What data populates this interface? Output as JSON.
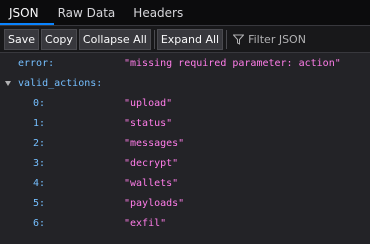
{
  "tabs": [
    {
      "label": "JSON",
      "active": true
    },
    {
      "label": "Raw Data",
      "active": false
    },
    {
      "label": "Headers",
      "active": false
    }
  ],
  "toolbar": {
    "save": "Save",
    "copy": "Copy",
    "collapse_all": "Collapse All",
    "expand_all": "Expand All",
    "filter_placeholder": "Filter JSON",
    "filter_icon": "funnel-icon"
  },
  "json": {
    "error_key": "error:",
    "error_value": "\"missing required parameter: action\"",
    "valid_actions_key": "valid_actions:",
    "valid_actions": [
      {
        "index": "0:",
        "value": "\"upload\""
      },
      {
        "index": "1:",
        "value": "\"status\""
      },
      {
        "index": "2:",
        "value": "\"messages\""
      },
      {
        "index": "3:",
        "value": "\"decrypt\""
      },
      {
        "index": "4:",
        "value": "\"wallets\""
      },
      {
        "index": "5:",
        "value": "\"payloads\""
      },
      {
        "index": "6:",
        "value": "\"exfil\""
      }
    ]
  },
  "colors": {
    "key": "#75bfff",
    "string": "#ff7de9",
    "active_tab_underline": "#0a84ff"
  }
}
